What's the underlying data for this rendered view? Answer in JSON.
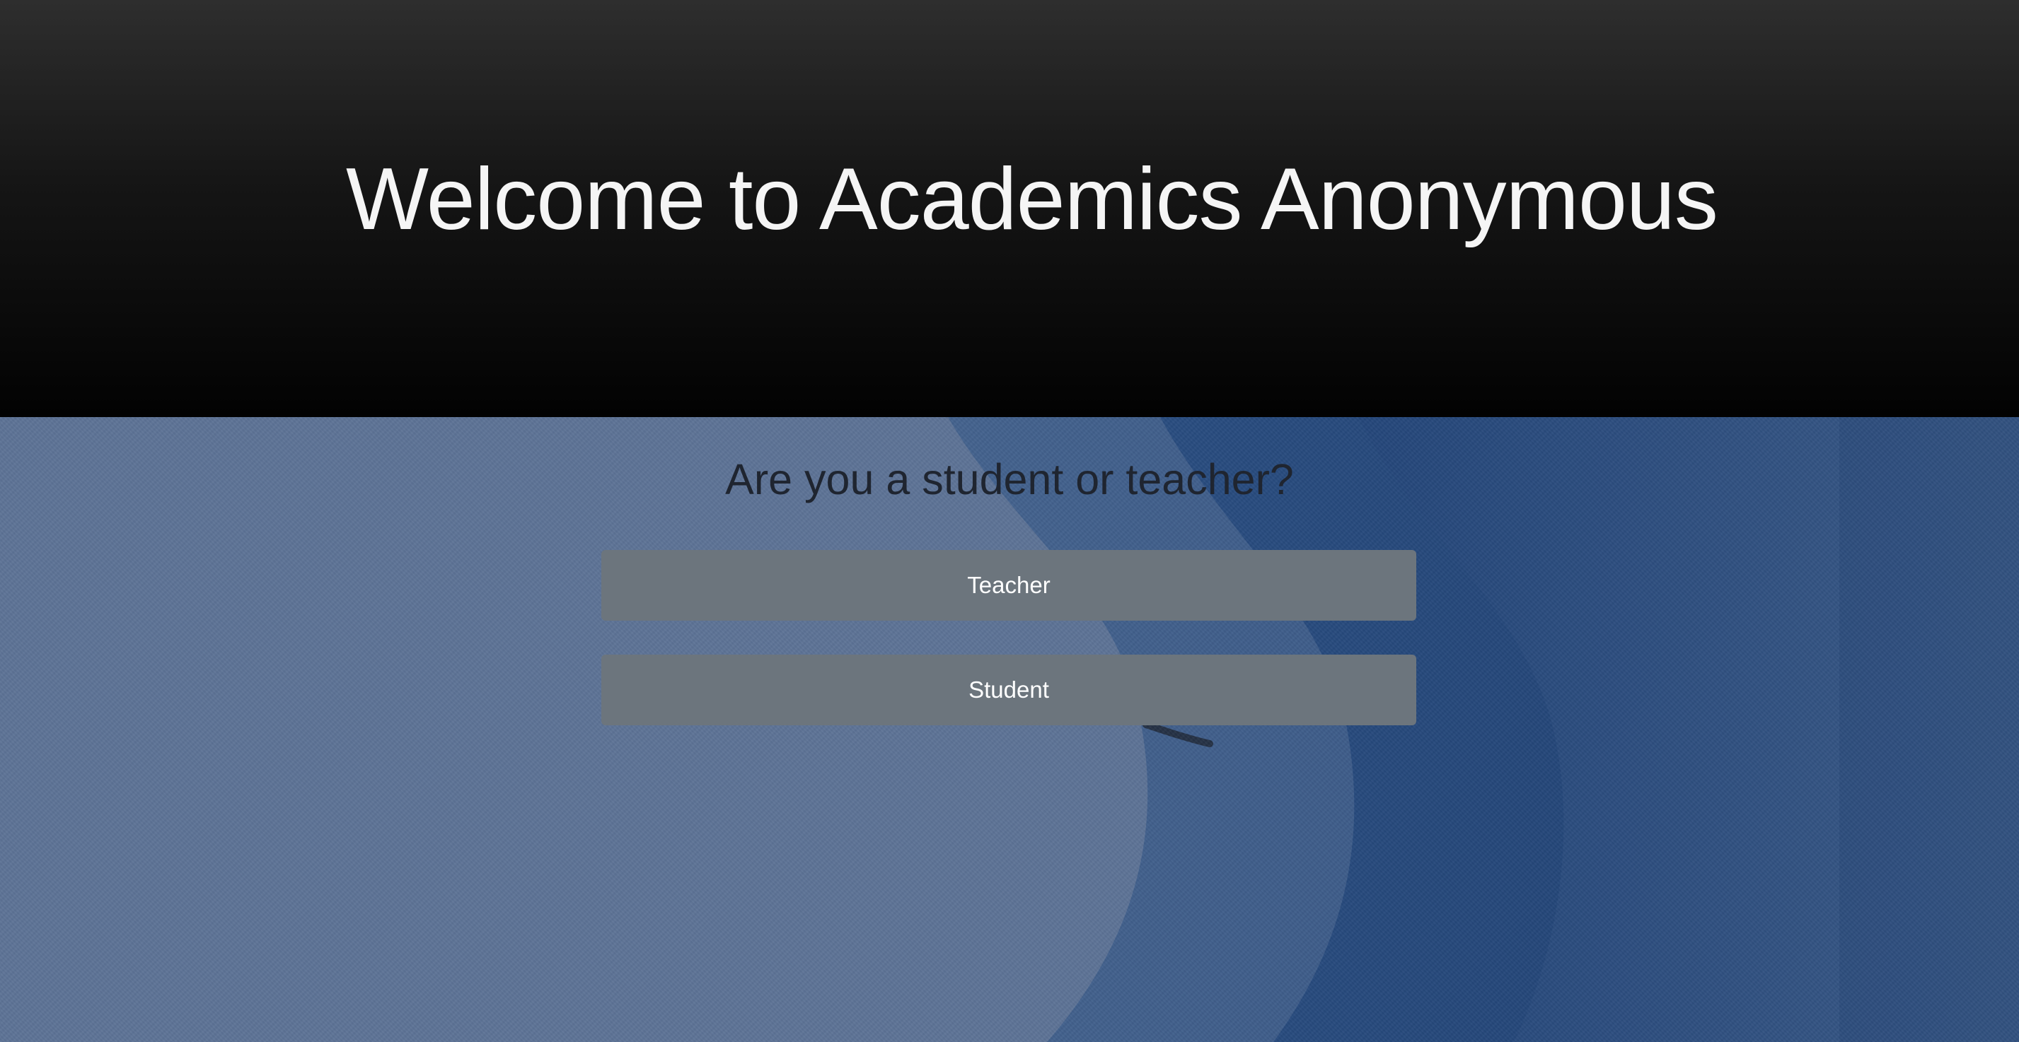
{
  "header": {
    "title": "Welcome to Academics Anonymous"
  },
  "main": {
    "question": "Are you a student or teacher?",
    "buttons": {
      "teacher_label": "Teacher",
      "student_label": "Student"
    }
  },
  "colors": {
    "header_top": "#2e2e2e",
    "header_bottom": "#020202",
    "hero_light_blue": "#5d7396",
    "hero_dark_blue": "#1f3f6f",
    "button_gray": "#6c757d",
    "title_text": "#f5f5f5",
    "question_text": "#1f2530"
  }
}
